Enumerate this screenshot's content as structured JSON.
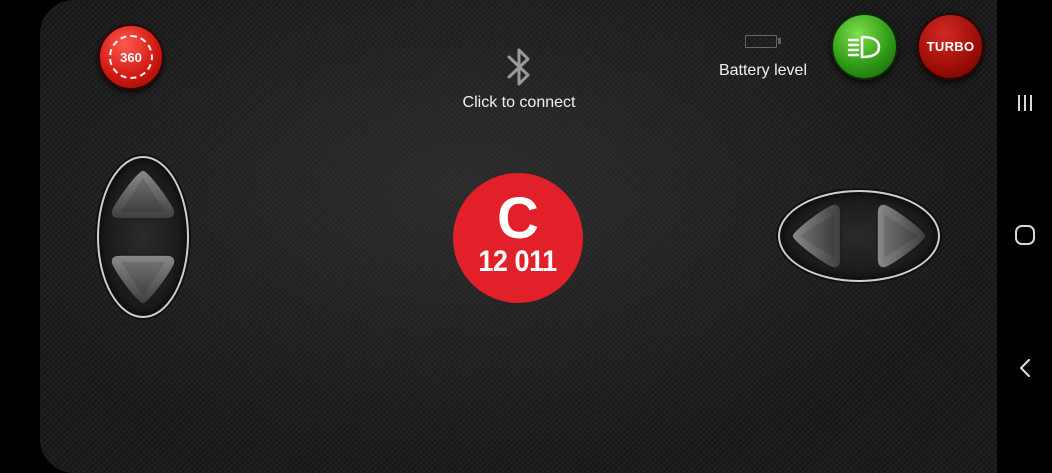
{
  "app": {
    "bluetooth": {
      "icon": "bluetooth-icon",
      "label": "Click to connect"
    },
    "battery": {
      "icon": "battery-empty-icon",
      "label": "Battery level"
    },
    "buttons": {
      "rotate": {
        "label": "360",
        "icon": "rotate-360-icon",
        "color": "#d21a12"
      },
      "headlight": {
        "icon": "headlight-icon",
        "color": "#2f9b17"
      },
      "turbo": {
        "label": "TURBO",
        "color": "#9c0d08"
      }
    },
    "badge": {
      "letter": "C",
      "number": "12 011",
      "color": "#e2202a"
    },
    "controls": {
      "throttle": {
        "up_icon": "arrow-up-icon",
        "down_icon": "arrow-down-icon"
      },
      "steering": {
        "left_icon": "arrow-left-icon",
        "right_icon": "arrow-right-icon"
      }
    }
  },
  "system_nav": {
    "recents_icon": "recents-icon",
    "home_icon": "home-icon",
    "back_icon": "back-icon"
  }
}
